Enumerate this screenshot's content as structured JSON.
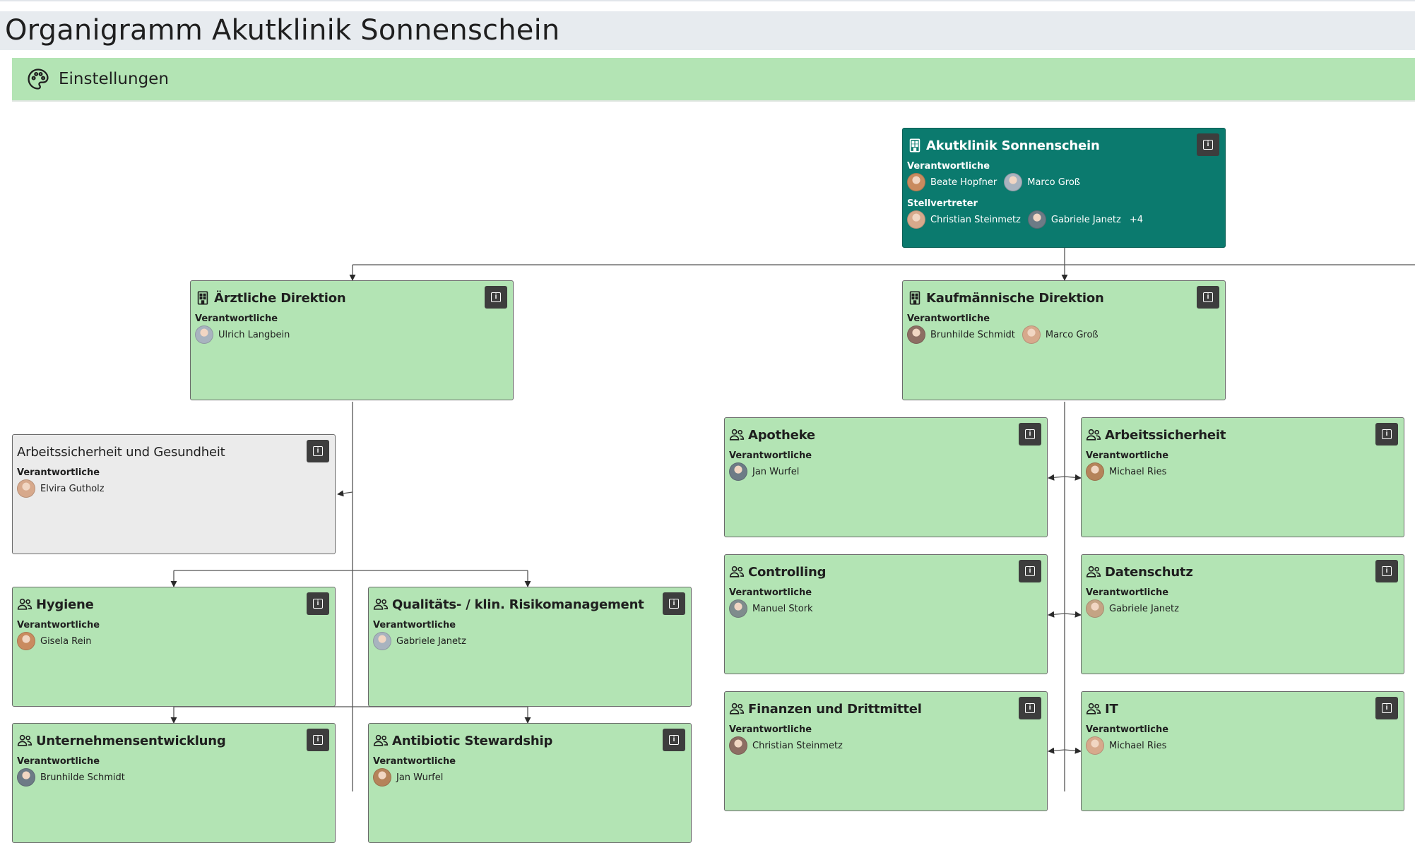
{
  "page": {
    "title": "Organigramm Akutklinik Sonnenschein"
  },
  "settings": {
    "label": "Einstellungen",
    "icon": "palette-icon"
  },
  "labels": {
    "responsible": "Verantwortliche",
    "deputy": "Stellvertreter"
  },
  "colors": {
    "teal": "#0b7a6e",
    "green": "#b3e4b4",
    "grey": "#ebebeb",
    "info_button": "#3d3d3d"
  },
  "units": [
    {
      "id": "root",
      "name": "Akutklinik Sonnenschein",
      "icon": "building-icon",
      "responsible": [
        "Beate Hopfner",
        "Marco Groß"
      ],
      "deputies": [
        "Christian Steinmetz",
        "Gabriele Janetz"
      ],
      "more": "+4"
    },
    {
      "id": "aerztlich",
      "name": "Ärztliche Direktion",
      "icon": "building-icon",
      "responsible": [
        "Ulrich Langbein"
      ]
    },
    {
      "id": "kaufm",
      "name": "Kaufmännische Direktion",
      "icon": "building-icon",
      "responsible": [
        "Brunhilde Schmidt",
        "Marco Groß"
      ]
    },
    {
      "id": "arbsich-ges",
      "name": "Arbeitssicherheit und Gesundheit",
      "icon": "",
      "responsible": [
        "Elvira Gutholz"
      ]
    },
    {
      "id": "apotheke",
      "name": "Apotheke",
      "icon": "group-icon",
      "responsible": [
        "Jan Wurfel"
      ]
    },
    {
      "id": "arbsich",
      "name": "Arbeitssicherheit",
      "icon": "group-icon",
      "responsible": [
        "Michael Ries"
      ]
    },
    {
      "id": "controlling",
      "name": "Controlling",
      "icon": "group-icon",
      "responsible": [
        "Manuel Stork"
      ]
    },
    {
      "id": "datenschutz",
      "name": "Datenschutz",
      "icon": "group-icon",
      "responsible": [
        "Gabriele Janetz"
      ]
    },
    {
      "id": "hygiene",
      "name": "Hygiene",
      "icon": "group-icon",
      "responsible": [
        "Gisela Rein"
      ]
    },
    {
      "id": "qualitaet",
      "name": "Qualitäts- / klin. Risikomanagement",
      "icon": "group-icon",
      "responsible": [
        "Gabriele Janetz"
      ]
    },
    {
      "id": "finanzen",
      "name": "Finanzen und Drittmittel",
      "icon": "group-icon",
      "responsible": [
        "Christian Steinmetz"
      ]
    },
    {
      "id": "it",
      "name": "IT",
      "icon": "group-icon",
      "responsible": [
        "Michael Ries"
      ]
    },
    {
      "id": "unternehmen",
      "name": "Unternehmensentwicklung",
      "icon": "group-icon",
      "responsible": [
        "Brunhilde Schmidt"
      ]
    },
    {
      "id": "abs",
      "name": "Antibiotic Stewardship",
      "icon": "group-icon",
      "responsible": [
        "Jan Wurfel"
      ]
    }
  ]
}
